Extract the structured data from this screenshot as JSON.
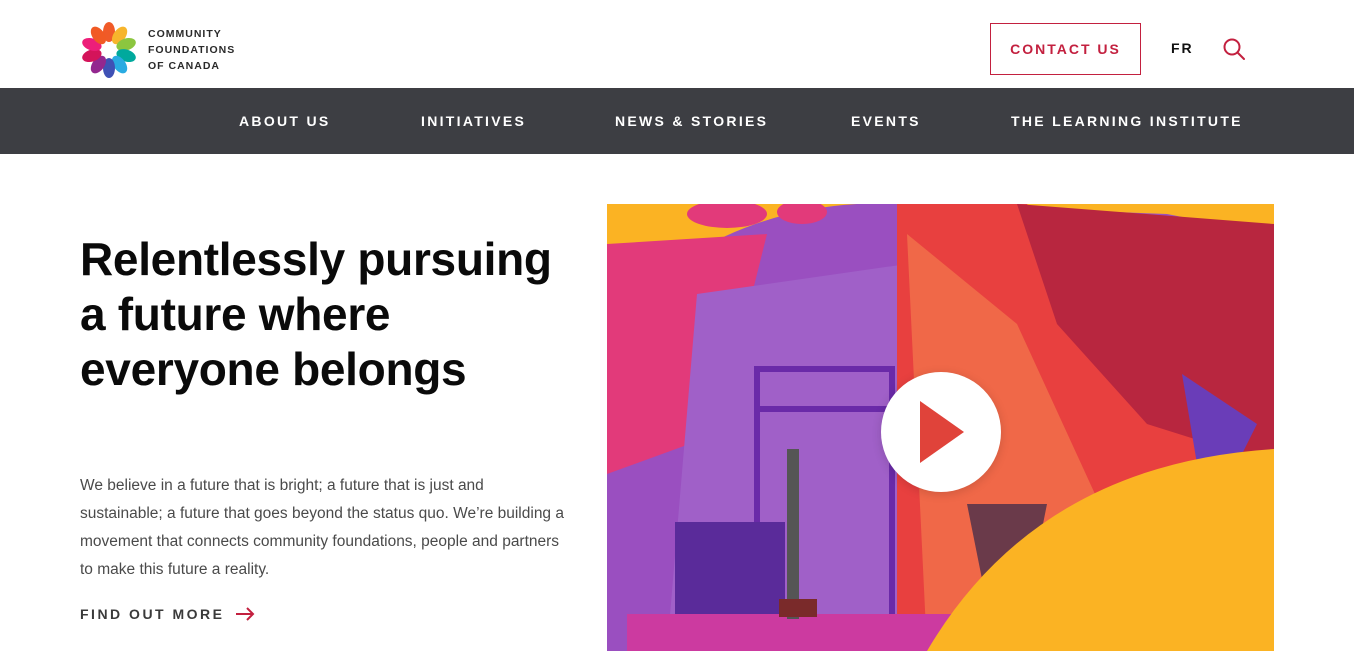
{
  "header": {
    "logo": {
      "line1": "COMMUNITY",
      "line2": "FOUNDATIONS",
      "line3": "OF CANADA",
      "icon": "pinwheel-logo-icon"
    },
    "contact_label": "CONTACT US",
    "lang_label": "FR",
    "search_icon": "search-icon"
  },
  "nav": {
    "items": [
      {
        "label": "ABOUT US"
      },
      {
        "label": "INITIATIVES"
      },
      {
        "label": "NEWS & STORIES"
      },
      {
        "label": "EVENTS"
      },
      {
        "label": "THE LEARNING INSTITUTE"
      }
    ]
  },
  "hero": {
    "headline": "Relentlessly pursuing a future where everyone belongs",
    "body": "We believe in a future that is bright; a future that is just and sustainable; a future that goes beyond the status quo. We’re building a movement that connects community foundations, people and partners to make this future a reality.",
    "cta_label": "FIND OUT MORE",
    "cta_icon": "arrow-right-icon",
    "video_icon": "play-icon"
  },
  "colors": {
    "accent": "#c3203f",
    "nav_bg": "#3d3e43",
    "yellow": "#fbb323",
    "purple": "#9b4fc0"
  }
}
